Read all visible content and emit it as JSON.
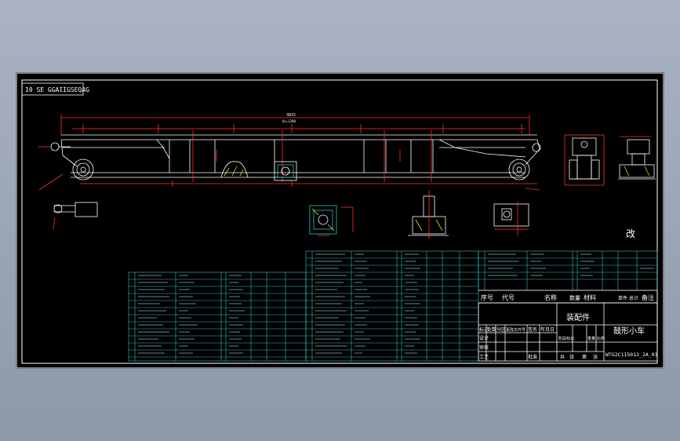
{
  "sheet": {
    "top_stamp": "10 SE GGAIIGSEQAG",
    "stray_note": "改"
  },
  "dimensions": {
    "overall": "3815",
    "overall_sub": "Qs=1200"
  },
  "title_block": {
    "headers": [
      "序号",
      "代号",
      "名称",
      "数量",
      "材料",
      "单件",
      "总计",
      "备注"
    ],
    "assembly_label": "装配件",
    "part_name": "鼓形小车",
    "drawing_code": "WTG2C115012_2A_01",
    "sign_labels": [
      "标记",
      "处数",
      "分区",
      "更改文件号",
      "签名",
      "年月日"
    ],
    "stage_labels": [
      "阶段标记",
      "重量",
      "比例"
    ],
    "sheet_labels": [
      "共",
      "张",
      "第",
      "张"
    ],
    "role_labels": [
      "设计",
      "审核",
      "工艺",
      "批准"
    ]
  },
  "colors": {
    "background": "#000000",
    "outline": "#ffffff",
    "dimension": "#ff3030",
    "table": "#27c6c6",
    "hatch": "#e8e02a"
  }
}
